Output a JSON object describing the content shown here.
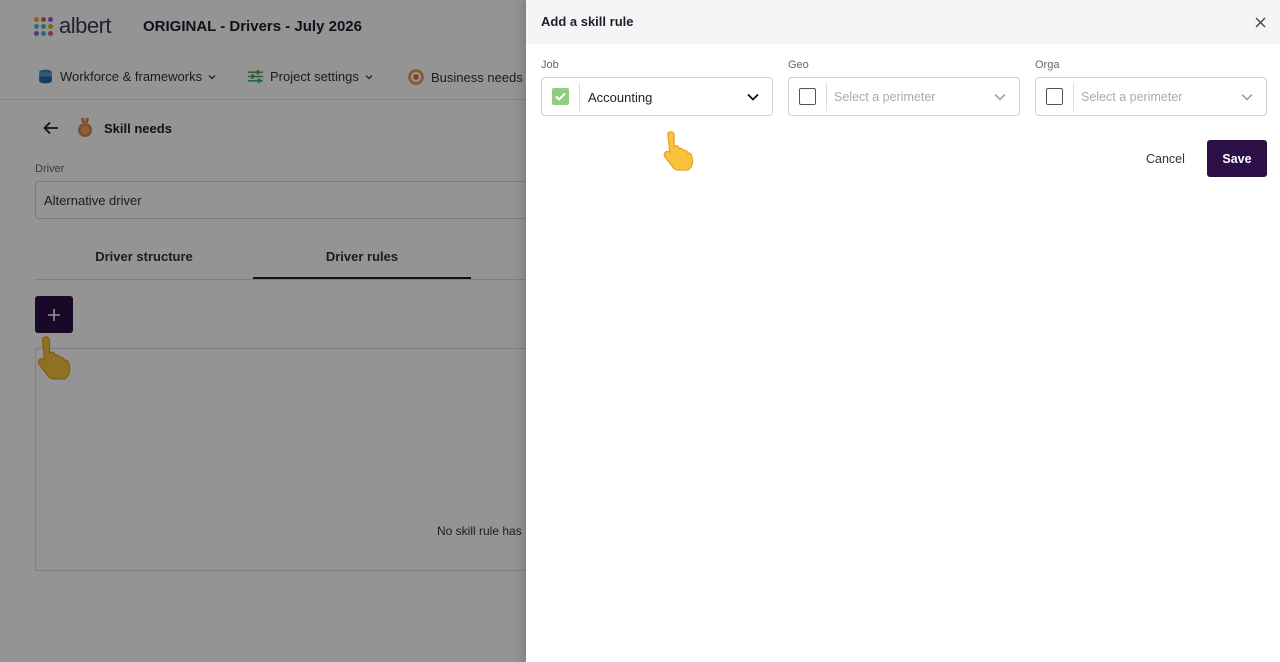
{
  "app": {
    "logo_text": "albert",
    "project_title": "ORIGINAL - Drivers - July 2026",
    "brand_color": "#2c0f46"
  },
  "nav": {
    "items": [
      {
        "label": "Workforce & frameworks",
        "icon": "database-icon"
      },
      {
        "label": "Project settings",
        "icon": "sliders-icon"
      },
      {
        "label": "Business needs",
        "icon": "target-icon"
      }
    ]
  },
  "page": {
    "title": "Skill needs",
    "driver_label": "Driver",
    "driver_value": "Alternative driver",
    "tabs": [
      {
        "label": "Driver structure",
        "active": false
      },
      {
        "label": "Driver rules",
        "active": true
      }
    ],
    "empty_message": "No skill rule has"
  },
  "drawer": {
    "title": "Add a skill rule",
    "fields": [
      {
        "label": "Job",
        "checked": true,
        "value": "Accounting",
        "placeholder": ""
      },
      {
        "label": "Geo",
        "checked": false,
        "value": "",
        "placeholder": "Select a perimeter"
      },
      {
        "label": "Orga",
        "checked": false,
        "value": "",
        "placeholder": "Select a perimeter"
      }
    ],
    "cancel_label": "Cancel",
    "save_label": "Save",
    "checkbox_color": "#8fce7e"
  }
}
